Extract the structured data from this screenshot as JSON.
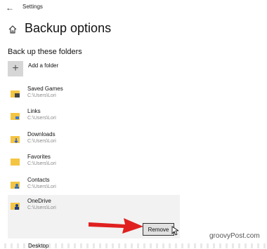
{
  "window": {
    "title": "Settings"
  },
  "header": {
    "page_title": "Backup options"
  },
  "section": {
    "title": "Back up these folders"
  },
  "add_folder": {
    "label": "Add a folder"
  },
  "folders": [
    {
      "name": "Saved Games",
      "path": "C:\\Users\\Lori",
      "icon": "saved-games-folder-icon"
    },
    {
      "name": "Links",
      "path": "C:\\Users\\Lori",
      "icon": "links-folder-icon"
    },
    {
      "name": "Downloads",
      "path": "C:\\Users\\Lori",
      "icon": "downloads-folder-icon"
    },
    {
      "name": "Favorites",
      "path": "C:\\Users\\Lori",
      "icon": "favorites-folder-icon"
    },
    {
      "name": "Contacts",
      "path": "C:\\Users\\Lori",
      "icon": "contacts-folder-icon"
    },
    {
      "name": "OneDrive",
      "path": "C:\\Users\\Lori",
      "icon": "onedrive-folder-icon"
    }
  ],
  "actions": {
    "remove_label": "Remove"
  },
  "partial_item": {
    "name": "Desktop"
  },
  "watermark": {
    "text": "groovyPost.com"
  },
  "colors": {
    "folder_yellow": "#f4c542",
    "arrow_red": "#e02020",
    "selected_bg": "#f2f2f2"
  }
}
